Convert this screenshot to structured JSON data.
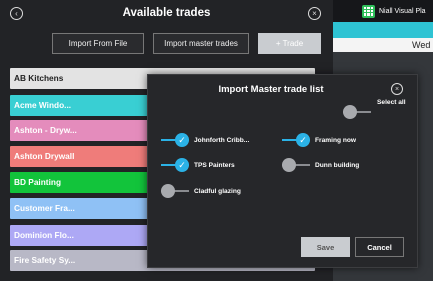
{
  "background_app": {
    "app_name": "Niall Visual Pla",
    "weekday_label": "Wed"
  },
  "panel": {
    "title": "Available trades",
    "back_icon": "‹",
    "close_icon": "×",
    "import_file_label": "Import From File",
    "import_master_label": "Import master trades",
    "add_trade_label": "+ Trade"
  },
  "trades": [
    {
      "name": "AB Kitchens",
      "color": "#e3e3e3",
      "text_color": "#222222"
    },
    {
      "name": "Acme Windo...",
      "color": "#39cfd3",
      "text_color": "#ffffff"
    },
    {
      "name": "Ashton - Dryw...",
      "color": "#e48cbc",
      "text_color": "#ffffff"
    },
    {
      "name": "Ashton Drywall",
      "color": "#ef7c7a",
      "text_color": "#ffffff"
    },
    {
      "name": "BD Painting",
      "color": "#12c43b",
      "text_color": "#ffffff"
    },
    {
      "name": "Customer Fra...",
      "color": "#8fc1f5",
      "text_color": "#ffffff"
    },
    {
      "name": "Dominion Flo...",
      "color": "#ada8f5",
      "text_color": "#ffffff"
    },
    {
      "name": "Fire Safety Sy...",
      "color": "#b8b8c6",
      "text_color": "#ffffff"
    }
  ],
  "modal": {
    "title": "Import Master trade list",
    "close_icon": "×",
    "select_all_label": "Select all",
    "check_icon": "✓",
    "items": [
      {
        "label": "Johnforth Cribb...",
        "on": true
      },
      {
        "label": "Framing now",
        "on": true
      },
      {
        "label": "TPS Painters",
        "on": true
      },
      {
        "label": "Dunn building",
        "on": false
      },
      {
        "label": "Cladful glazing",
        "on": false
      }
    ],
    "save_label": "Save",
    "cancel_label": "Cancel"
  }
}
